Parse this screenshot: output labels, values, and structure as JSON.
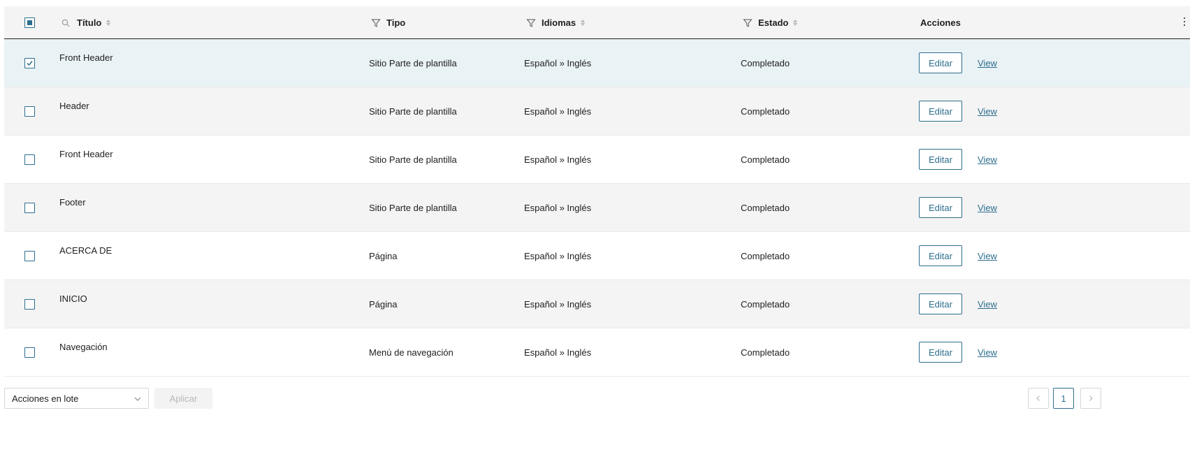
{
  "columns": {
    "title": "Título",
    "type": "Tipo",
    "languages": "Idiomas",
    "status": "Estado",
    "actions": "Acciones"
  },
  "rows": [
    {
      "title": "Front Header",
      "type": "Sitio Parte de plantilla",
      "languages": "Español » Inglés",
      "status": "Completado",
      "edit": "Editar",
      "view": "View",
      "checked": true
    },
    {
      "title": "Header",
      "type": "Sitio Parte de plantilla",
      "languages": "Español » Inglés",
      "status": "Completado",
      "edit": "Editar",
      "view": "View",
      "checked": false
    },
    {
      "title": "Front Header",
      "type": "Sitio Parte de plantilla",
      "languages": "Español » Inglés",
      "status": "Completado",
      "edit": "Editar",
      "view": "View",
      "checked": false
    },
    {
      "title": "Footer",
      "type": "Sitio Parte de plantilla",
      "languages": "Español » Inglés",
      "status": "Completado",
      "edit": "Editar",
      "view": "View",
      "checked": false
    },
    {
      "title": "ACERCA DE",
      "type": "Página",
      "languages": "Español » Inglés",
      "status": "Completado",
      "edit": "Editar",
      "view": "View",
      "checked": false
    },
    {
      "title": "INICIO",
      "type": "Página",
      "languages": "Español » Inglés",
      "status": "Completado",
      "edit": "Editar",
      "view": "View",
      "checked": false
    },
    {
      "title": "Navegación",
      "type": "Menú de navegación",
      "languages": "Español » Inglés",
      "status": "Completado",
      "edit": "Editar",
      "view": "View",
      "checked": false
    }
  ],
  "footer": {
    "bulk_actions": "Acciones en lote",
    "apply": "Aplicar",
    "current_page": "1"
  },
  "colors": {
    "accent": "#2d6e8e",
    "row_alt": "#f4f4f4",
    "row_selected": "#e9f2f5"
  }
}
